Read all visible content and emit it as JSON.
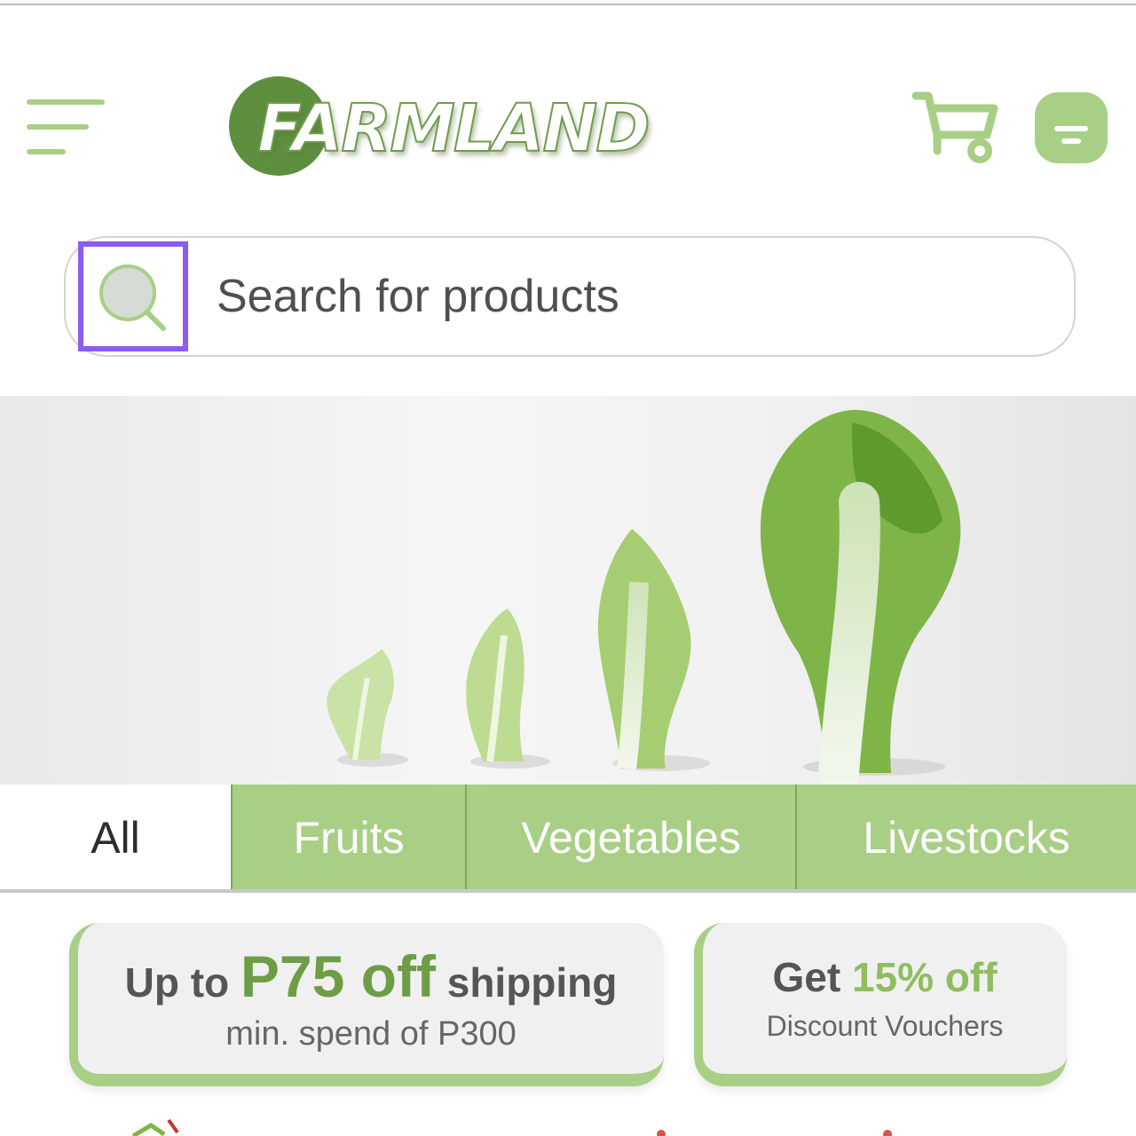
{
  "brand": {
    "name": "FARMLAND",
    "colors": {
      "primary": "#a8cf85",
      "dark": "#5d8f3e",
      "focus": "#8b5cf0"
    }
  },
  "header": {
    "menu_icon": "hamburger-menu-icon",
    "cart_icon": "cart-icon",
    "profile_icon": "profile-icon"
  },
  "search": {
    "placeholder": "Search for products",
    "icon": "search-icon"
  },
  "tabs": [
    {
      "label": "All",
      "active": true
    },
    {
      "label": "Fruits",
      "active": false
    },
    {
      "label": "Vegetables",
      "active": false
    },
    {
      "label": "Livestocks",
      "active": false
    }
  ],
  "promos": [
    {
      "prefix": "Up to",
      "highlight": "P75 off",
      "suffix": "shipping",
      "subtitle": "min. spend of P300"
    },
    {
      "prefix": "Get",
      "highlight": "15% off",
      "subtitle": "Discount Vouchers"
    }
  ]
}
